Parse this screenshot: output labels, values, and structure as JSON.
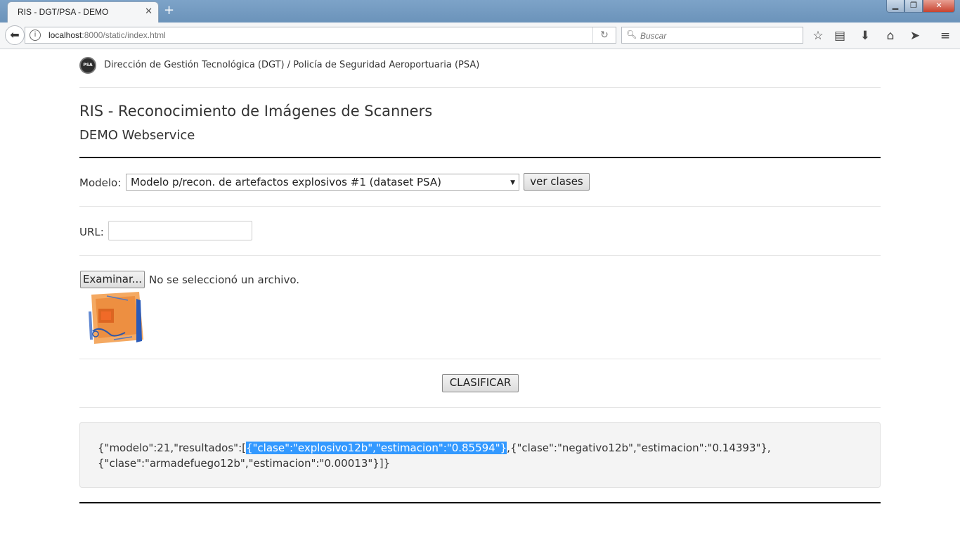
{
  "browser": {
    "tab_title": "RIS - DGT/PSA - DEMO",
    "url_host": "localhost",
    "url_rest": ":8000/static/index.html",
    "search_placeholder": "Buscar"
  },
  "header": {
    "org_logo_text": "PSA",
    "org_text": "Dirección de Gestión Tecnológica (DGT) / Policía de Seguridad Aeroportuaria (PSA)",
    "title": "RIS - Reconocimiento de Imágenes de Scanners",
    "subtitle": "DEMO Webservice"
  },
  "form": {
    "model_label": "Modelo:",
    "model_selected": "Modelo p/recon. de artefactos explosivos #1 (dataset PSA)",
    "ver_clases_label": "ver clases",
    "url_label": "URL:",
    "url_value": "",
    "browse_label": "Examinar...",
    "file_status": "No se seleccionó un archivo.",
    "classify_label": "CLASIFICAR"
  },
  "result": {
    "prefix": "{\"modelo\":21,\"resultados\":[",
    "highlighted": "{\"clase\":\"explosivo12b\",\"estimacion\":\"0.85594\"}",
    "line1_rest": ",{\"clase\":\"negativo12b\",\"estimacion\":\"0.14393\"},",
    "line2": "{\"clase\":\"armadefuego12b\",\"estimacion\":\"0.00013\"}]}"
  }
}
